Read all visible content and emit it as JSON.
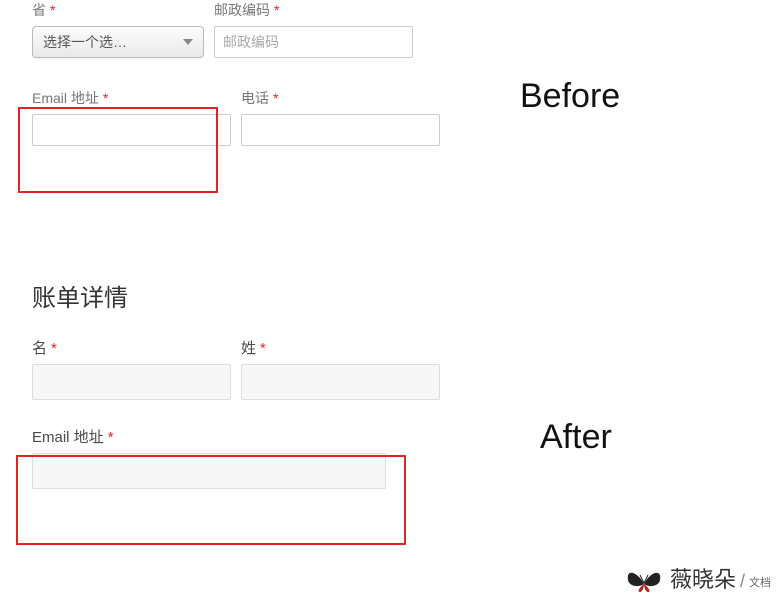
{
  "before": {
    "province": {
      "label": "省",
      "required": "*",
      "selected": "选择一个选…"
    },
    "postcode": {
      "label": "邮政编码",
      "required": "*",
      "placeholder": "邮政编码"
    },
    "email": {
      "label": "Email 地址",
      "required": "*"
    },
    "phone": {
      "label": "电话",
      "required": "*"
    },
    "tag": "Before"
  },
  "after": {
    "heading": "账单详情",
    "first_name": {
      "label": "名",
      "required": "*"
    },
    "last_name": {
      "label": "姓",
      "required": "*"
    },
    "email": {
      "label": "Email 地址",
      "required": "*"
    },
    "tag": "After"
  },
  "watermark": {
    "name": "薇晓朵",
    "sub": "文档"
  }
}
